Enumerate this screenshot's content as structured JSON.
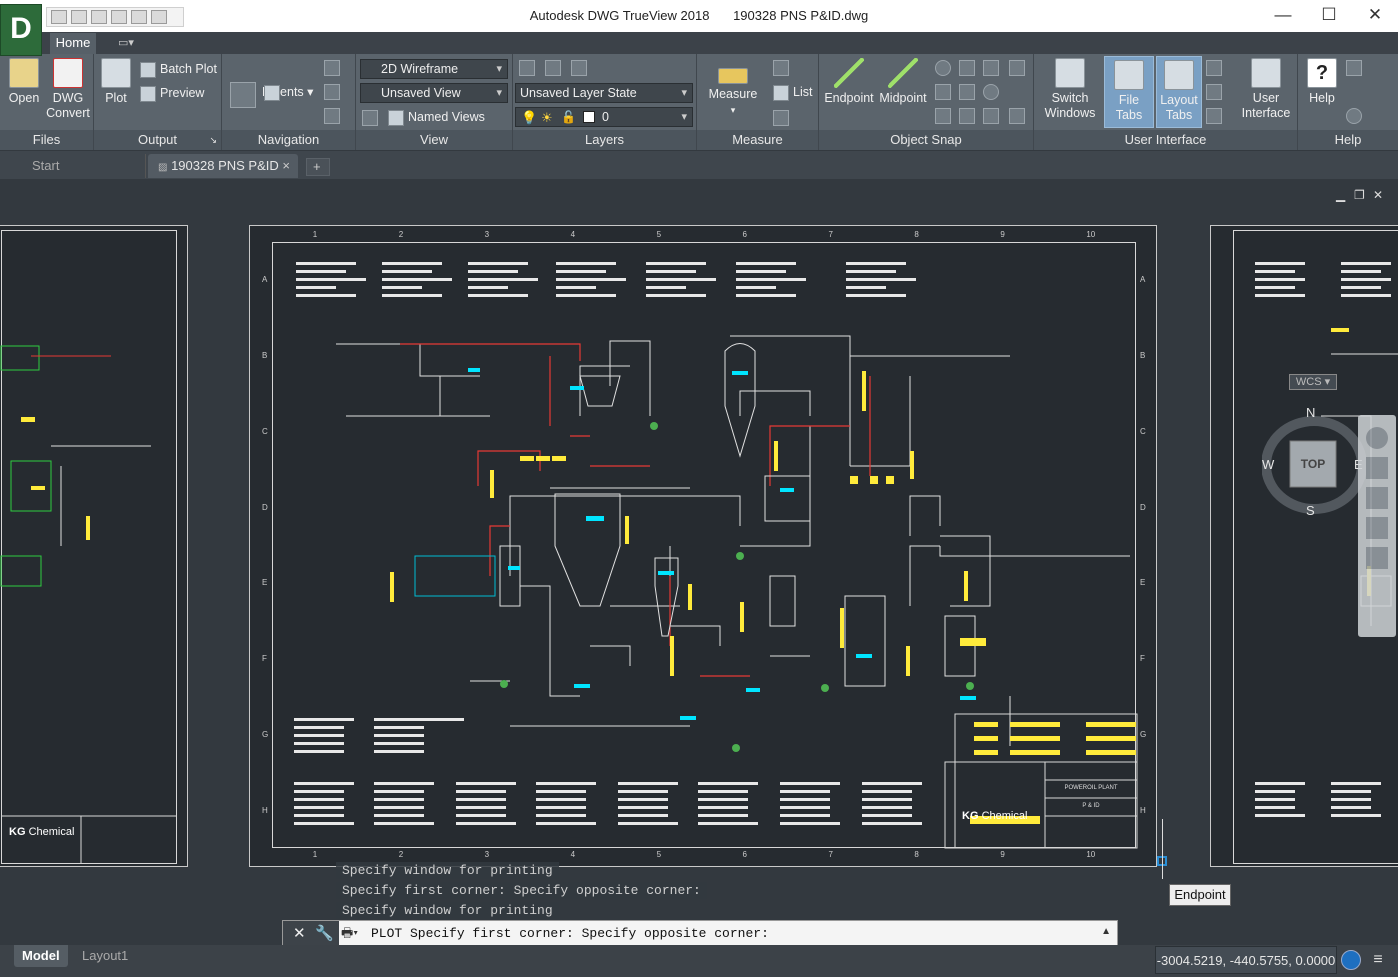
{
  "window": {
    "app_title": "Autodesk DWG TrueView 2018",
    "file_title": "190328 PNS P&ID.dwg",
    "app_letter": "D",
    "controls": [
      "—",
      "☐",
      "✕"
    ]
  },
  "ribbon_tabs": {
    "home": "Home"
  },
  "ribbon": {
    "files": {
      "title": "Files",
      "open": "Open",
      "dwg_convert_1": "DWG",
      "dwg_convert_2": "Convert"
    },
    "output": {
      "title": "Output",
      "plot": "Plot",
      "batch_plot": "Batch Plot",
      "preview": "Preview"
    },
    "navigation": {
      "title": "Navigation",
      "extents": "Extents"
    },
    "view": {
      "title": "View",
      "visual_style": "2D Wireframe",
      "view_state": "Unsaved View",
      "named_views": "Named Views"
    },
    "layers": {
      "title": "Layers",
      "layer_state": "Unsaved Layer State",
      "current_layer": "0"
    },
    "measure": {
      "title": "Measure",
      "measure": "Measure",
      "list": "List"
    },
    "object_snap": {
      "title": "Object Snap",
      "endpoint": "Endpoint",
      "midpoint": "Midpoint"
    },
    "user_interface": {
      "title": "User Interface",
      "switch_1": "Switch",
      "switch_2": "Windows",
      "file_tabs": "File Tabs",
      "layout_1": "Layout",
      "layout_2": "Tabs",
      "user_1": "User",
      "user_2": "Interface"
    },
    "help": {
      "title": "Help",
      "help": "Help"
    }
  },
  "doc_tabs": {
    "start": "Start",
    "active": "190328 PNS P&ID",
    "close": "×",
    "add": "+"
  },
  "drawing": {
    "company": "Chemical",
    "company_mark": "KG",
    "title_block_text": "POWEROIL PLANT",
    "doc_type": "P & ID",
    "grid_numbers": [
      "1",
      "2",
      "3",
      "4",
      "5",
      "6",
      "7",
      "8",
      "9",
      "10"
    ],
    "grid_letters": [
      "A",
      "B",
      "C",
      "D",
      "E",
      "F",
      "G",
      "H"
    ]
  },
  "navcube": {
    "north": "N",
    "south": "S",
    "west": "W",
    "east": "E",
    "face": "TOP",
    "wcs": "WCS"
  },
  "command_history": [
    "Specify window for printing",
    "Specify first corner: Specify opposite corner:",
    "Specify window for printing"
  ],
  "command_line": {
    "prompt": "PLOT Specify first corner: Specify opposite corner:"
  },
  "tooltip": "Endpoint",
  "layout_tabs": {
    "model": "Model",
    "layout1": "Layout1"
  },
  "coordinates": "-3004.5219, -440.5755, 0.0000",
  "colors": {
    "accent": "#2d6b3a",
    "ribbon": "#5b646c",
    "canvas": "#33393f",
    "sheet": "#262b30"
  }
}
